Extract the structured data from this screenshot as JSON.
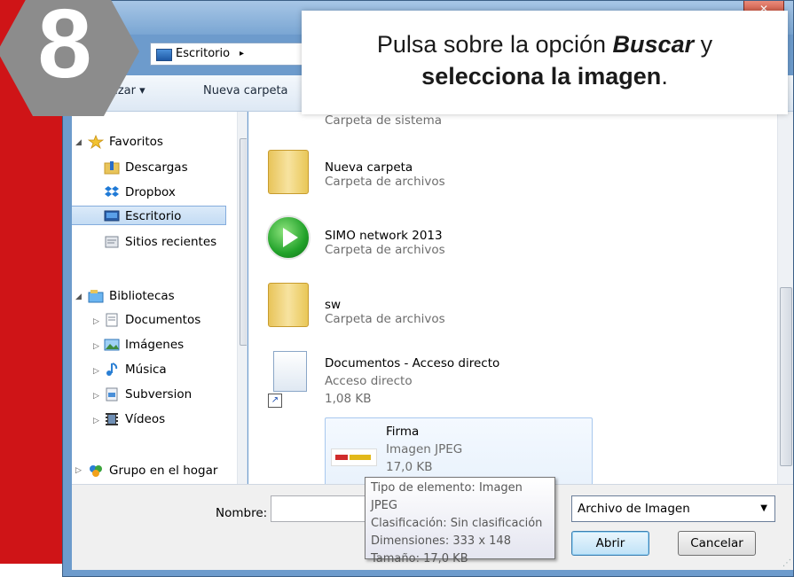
{
  "step": {
    "number": "8"
  },
  "callout": {
    "line1_pre": "Pulsa sobre la opción ",
    "line1_em": "Buscar",
    "line1_post": " y",
    "line2_bold": "selecciona la imagen",
    "line2_post": "."
  },
  "titlebar": {
    "close_label": "✕"
  },
  "address": {
    "location": "Escritorio",
    "chevron": "▸"
  },
  "toolbar": {
    "organize_label": "nizar ▾",
    "new_folder_label": "Nueva carpeta"
  },
  "nav": {
    "items": [
      {
        "label": "Favoritos",
        "icon": "star-icon"
      },
      {
        "label": "Descargas",
        "icon": "downloads-folder-icon"
      },
      {
        "label": "Dropbox",
        "icon": "dropbox-icon"
      },
      {
        "label": "Escritorio",
        "icon": "desktop-icon",
        "selected": true
      },
      {
        "label": "Sitios recientes",
        "icon": "recent-places-icon"
      },
      {
        "label": "Bibliotecas",
        "icon": "libraries-icon"
      },
      {
        "label": "Documentos",
        "icon": "documents-icon"
      },
      {
        "label": "Imágenes",
        "icon": "pictures-icon"
      },
      {
        "label": "Música",
        "icon": "music-icon"
      },
      {
        "label": "Subversion",
        "icon": "subversion-icon"
      },
      {
        "label": "Vídeos",
        "icon": "videos-icon"
      },
      {
        "label": "Grupo en el hogar",
        "icon": "homegroup-icon"
      }
    ]
  },
  "content": {
    "items": [
      {
        "name": "",
        "type": "Carpeta de sistema",
        "size": ""
      },
      {
        "name": "Nueva carpeta",
        "type": "Carpeta de archivos",
        "size": ""
      },
      {
        "name": "SIMO network 2013",
        "type": "Carpeta de archivos",
        "size": ""
      },
      {
        "name": "sw",
        "type": "Carpeta de archivos",
        "size": ""
      },
      {
        "name": "Documentos - Acceso directo",
        "type": "Acceso directo",
        "size": "1,08 KB"
      },
      {
        "name": "Firma",
        "type": "Imagen JPEG",
        "size": "17,0 KB"
      }
    ]
  },
  "tooltip": {
    "line1": "Tipo de elemento: Imagen JPEG",
    "line2": "Clasificación: Sin clasificación",
    "line3": "Dimensiones: 333 x 148",
    "line4": "Tamaño: 17,0 KB"
  },
  "bottom": {
    "name_label": "Nombre:",
    "name_value": "",
    "file_type_value": "Archivo de Imagen",
    "open_label": "Abrir",
    "cancel_label": "Cancelar"
  },
  "colors": {
    "background": "#cf1417",
    "dialog_frame": "#6d9bcc",
    "selection": "#c4dcf4",
    "badge": "#8c8c8c"
  }
}
